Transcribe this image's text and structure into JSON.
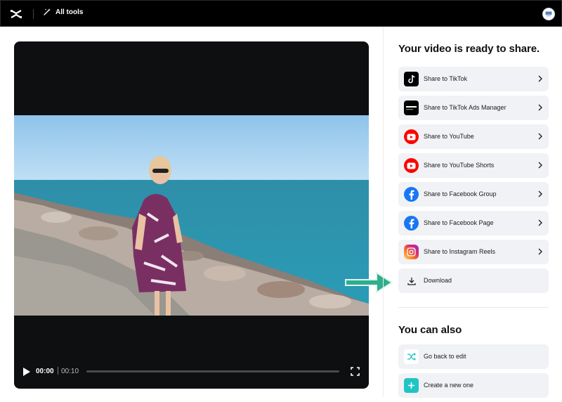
{
  "header": {
    "all_tools_label": "All tools"
  },
  "player": {
    "current_time": "00:00",
    "duration": "00:10",
    "progress_fraction": 0
  },
  "share_panel": {
    "title": "Your video is ready to share.",
    "items": [
      {
        "label": "Share to TikTok",
        "icon": "tiktok-icon"
      },
      {
        "label": "Share to TikTok Ads Manager",
        "icon": "tiktok-ads-icon"
      },
      {
        "label": "Share to YouTube",
        "icon": "youtube-icon"
      },
      {
        "label": "Share to YouTube Shorts",
        "icon": "youtube-icon"
      },
      {
        "label": "Share to Facebook Group",
        "icon": "facebook-icon"
      },
      {
        "label": "Share to Facebook Page",
        "icon": "facebook-icon"
      },
      {
        "label": "Share to Instagram Reels",
        "icon": "instagram-icon"
      },
      {
        "label": "Download",
        "icon": "download-icon"
      }
    ]
  },
  "also_panel": {
    "title": "You can also",
    "items": [
      {
        "label": "Go back to edit",
        "icon": "shuffle-icon"
      },
      {
        "label": "Create a new one",
        "icon": "plus-icon"
      }
    ]
  },
  "colors": {
    "topbar": "#000000",
    "item_bg": "#f0f2f5",
    "youtube_red": "#ff0000",
    "facebook_blue": "#1877f2",
    "teal_accent": "#21c4c4",
    "arrow_green": "#2fae8c"
  }
}
